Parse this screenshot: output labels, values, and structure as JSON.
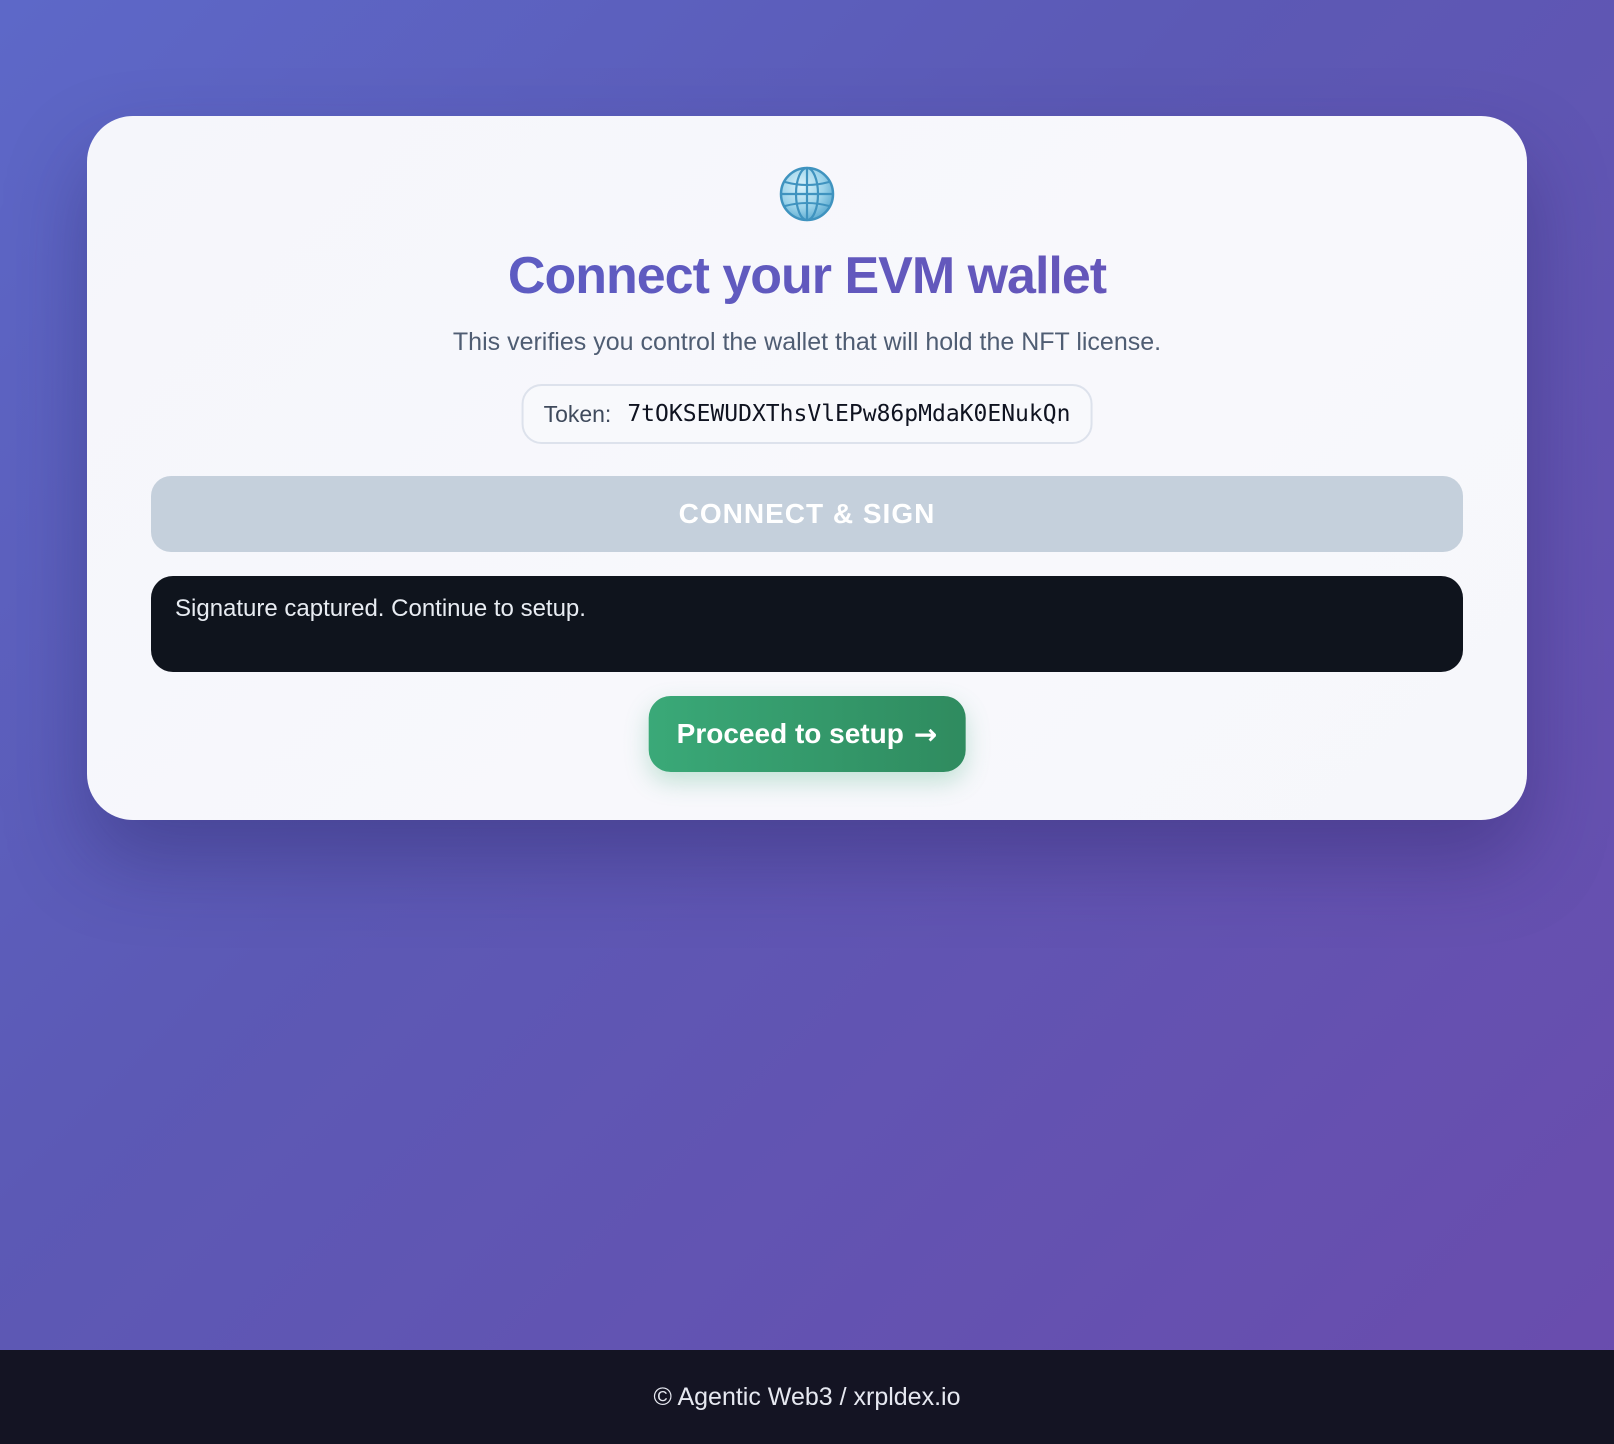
{
  "card": {
    "icon": "globe-icon",
    "title": "Connect your EVM wallet",
    "subtitle": "This verifies you control the wallet that will hold the NFT license.",
    "token_label": "Token:",
    "token_value": "7tOKSEWUDXThsVlEPw86pMdaK0ENukQn",
    "connect_label": "CONNECT & SIGN",
    "status_message": "Signature captured. Continue to setup.",
    "proceed_label": "Proceed to setup",
    "proceed_arrow": "→"
  },
  "footer": {
    "text": "© Agentic Web3 / xrpldex.io"
  },
  "colors": {
    "background_start": "#5d68c8",
    "background_end": "#6a4cad",
    "title": "#5b5fc4",
    "connect_button_disabled": "#c5d0dc",
    "status_bg": "#0f141d",
    "proceed_button": "#3aa978",
    "footer_bg": "#141423"
  }
}
